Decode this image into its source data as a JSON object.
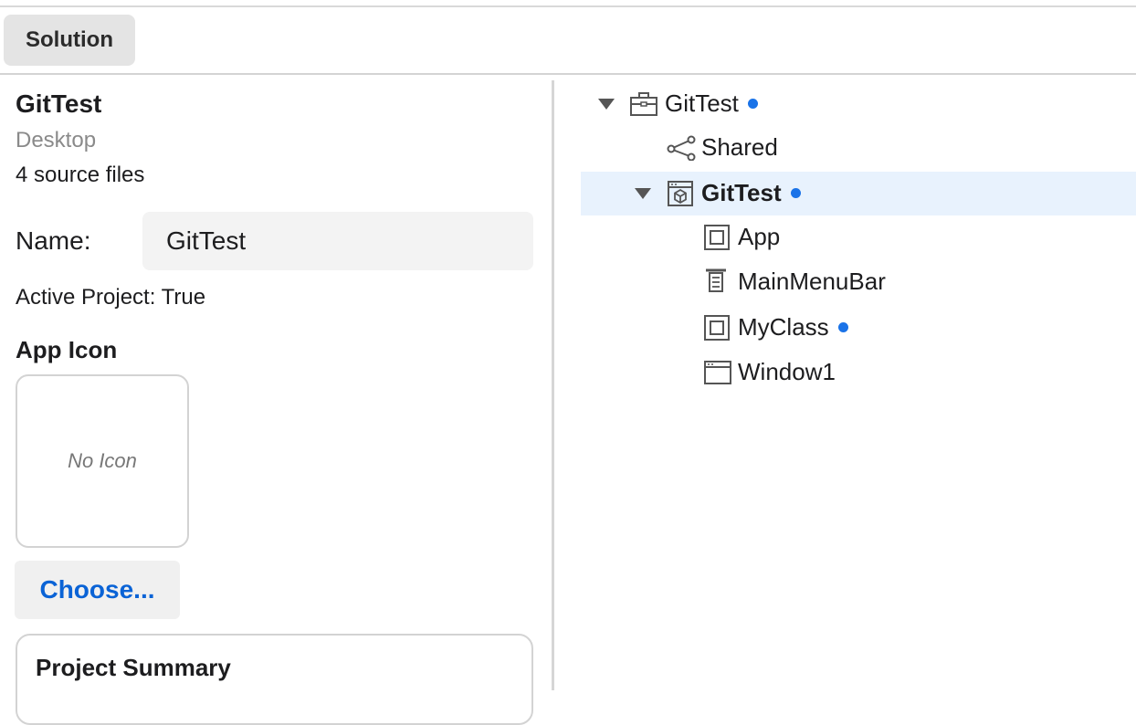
{
  "toolbar": {
    "solution_tab": "Solution"
  },
  "project": {
    "name": "GitTest",
    "type": "Desktop",
    "files": "4 source files",
    "name_label": "Name:",
    "name_value": "GitTest",
    "active": "Active Project: True",
    "app_icon_heading": "App Icon",
    "no_icon": "No Icon",
    "choose_label": "Choose...",
    "summary_title": "Project Summary"
  },
  "tree": {
    "items": [
      {
        "label": "GitTest",
        "icon": "briefcase-icon",
        "modified": true,
        "expanded": true
      },
      {
        "label": "Shared",
        "icon": "share-icon",
        "modified": false
      },
      {
        "label": "GitTest",
        "icon": "project-cube-icon",
        "modified": true,
        "expanded": true,
        "selected": true
      },
      {
        "label": "App",
        "icon": "class-icon",
        "modified": false
      },
      {
        "label": "MainMenuBar",
        "icon": "menubar-icon",
        "modified": false
      },
      {
        "label": "MyClass",
        "icon": "class-icon",
        "modified": true
      },
      {
        "label": "Window1",
        "icon": "window-icon",
        "modified": false
      }
    ]
  },
  "colors": {
    "accent": "#0a63d6",
    "modified_dot": "#1a73e8",
    "selection": "#e8f2fd"
  }
}
